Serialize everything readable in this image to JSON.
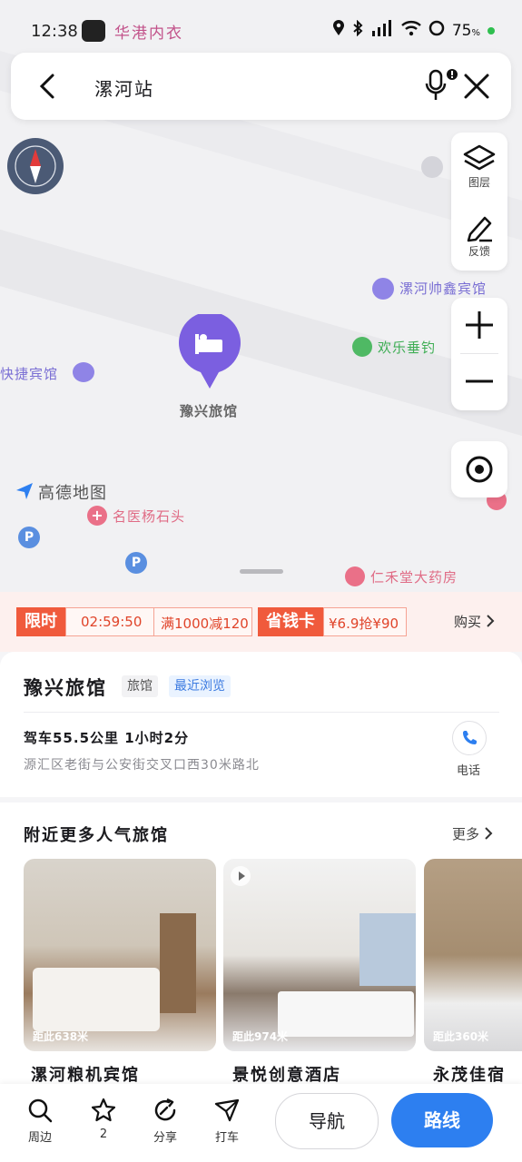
{
  "status_bar": {
    "time": "12:38",
    "app_text": "华港内衣",
    "battery": "75",
    "battery_unit": "%"
  },
  "search": {
    "query": "漯河站"
  },
  "map_tools": {
    "layers_label": "图层",
    "feedback_label": "反馈"
  },
  "map_pois": {
    "selected": "豫兴旅馆",
    "shuaixin": "漯河帅鑫宾馆",
    "huanle": "欢乐垂钓",
    "kuaijie": "快捷宾馆",
    "mingyi": "名医杨石头",
    "renhetang": "仁禾堂大药房",
    "logo": "高德地图",
    "parking": "P"
  },
  "promo": {
    "limited_tag": "限时",
    "countdown": "02:59:50",
    "discount": "满1000减120",
    "card_tag": "省钱卡",
    "card_offer": "¥6.9抢¥90",
    "buy": "购买"
  },
  "poi_card": {
    "name": "豫兴旅馆",
    "category": "旅馆",
    "recent": "最近浏览",
    "drive": "驾车55.5公里 1小时2分",
    "address": "源汇区老街与公安街交叉口西30米路北",
    "phone_label": "电话"
  },
  "nearby": {
    "title": "附近更多人气旅馆",
    "more": "更多",
    "hotels": [
      {
        "name": "漯河粮机宾馆",
        "distance": "距此638米"
      },
      {
        "name": "景悦创意酒店",
        "distance": "距此974米"
      },
      {
        "name": "永茂佳宿",
        "distance": "距此360米"
      }
    ]
  },
  "bottom_bar": {
    "nearby": "周边",
    "favorite": "2",
    "share": "分享",
    "taxi": "打车",
    "navigate": "导航",
    "route": "路线"
  },
  "colors": {
    "accent_blue": "#2d7ff0",
    "promo_red": "#f05a3c",
    "poi_purple": "#7a6fd4"
  }
}
